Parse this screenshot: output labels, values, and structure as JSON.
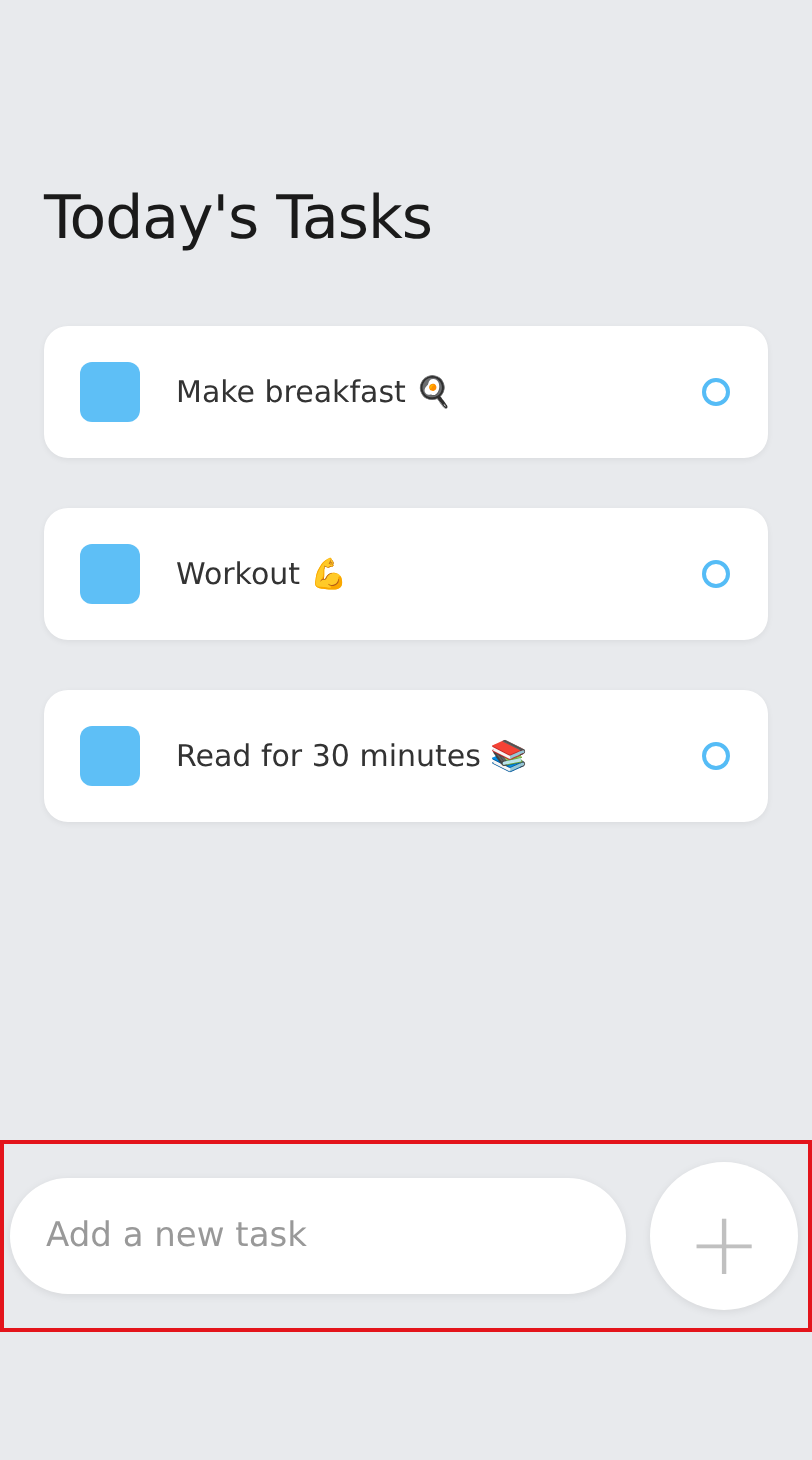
{
  "title": "Today's Tasks",
  "tasks": [
    {
      "text": "Make breakfast 🍳",
      "completed": false
    },
    {
      "text": "Workout 💪",
      "completed": false
    },
    {
      "text": "Read for 30 minutes 📚",
      "completed": false
    }
  ],
  "new_task": {
    "placeholder": "Add a new task",
    "button": "+"
  }
}
